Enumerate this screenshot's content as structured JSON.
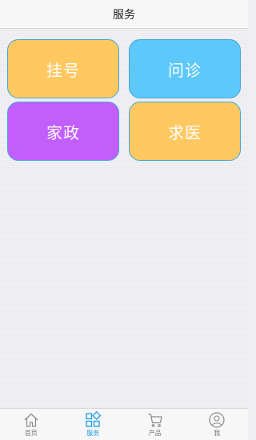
{
  "navbar": {
    "title": "服务"
  },
  "tiles": [
    {
      "label": "挂号",
      "bg": "#ffc861",
      "border": "#3fa8d8"
    },
    {
      "label": "问诊",
      "bg": "#5ec8fb",
      "border": "#3fa8d8"
    },
    {
      "label": "家政",
      "bg": "#c25efb",
      "border": "#3fa8d8"
    },
    {
      "label": "求医",
      "bg": "#ffc861",
      "border": "#3fa8d8"
    }
  ],
  "tabbar": {
    "active_color": "#1a9be8",
    "inactive_color": "#7a7a7a",
    "items": [
      {
        "label": "首页",
        "icon": "home-icon",
        "active": false
      },
      {
        "label": "服务",
        "icon": "grid-icon",
        "active": true
      },
      {
        "label": "产品",
        "icon": "cart-icon",
        "active": false
      },
      {
        "label": "我",
        "icon": "user-icon",
        "active": false
      }
    ]
  }
}
